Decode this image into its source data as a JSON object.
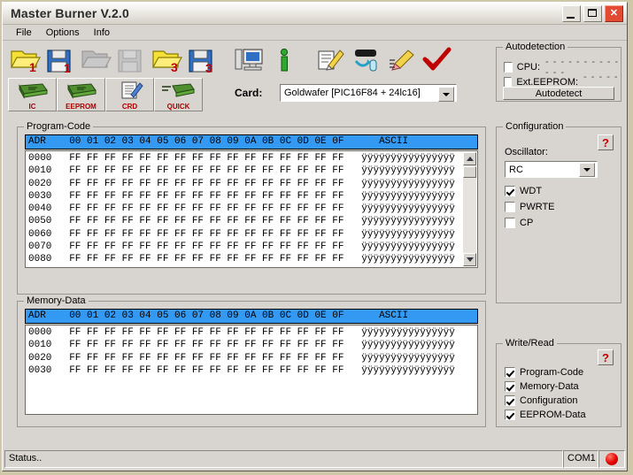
{
  "window": {
    "title": "Master Burner V.2.0",
    "minimize_label": "Minimize",
    "maximize_label": "Maximize",
    "close_label": "✕"
  },
  "menu": [
    "File",
    "Options",
    "Info"
  ],
  "toolbar": {
    "icons": [
      {
        "name": "open-program-file-1",
        "badge": "1"
      },
      {
        "name": "save-program-file-1",
        "badge": "1"
      },
      {
        "name": "open-file-disabled",
        "badge": ""
      },
      {
        "name": "save-file-disabled",
        "badge": ""
      },
      {
        "name": "open-file-3",
        "badge": "3"
      },
      {
        "name": "save-file-3",
        "badge": "3"
      },
      {
        "name": "computer-settings",
        "badge": ""
      },
      {
        "name": "info",
        "badge": ""
      },
      {
        "name": "write-card",
        "badge": ""
      },
      {
        "name": "read-card",
        "badge": ""
      },
      {
        "name": "erase-card",
        "badge": ""
      },
      {
        "name": "verify-card",
        "badge": ""
      }
    ]
  },
  "card_tabs": [
    {
      "label": "IC"
    },
    {
      "label": "EEPROM"
    },
    {
      "label": "CRD"
    },
    {
      "label": "QUICK"
    }
  ],
  "card": {
    "label": "Card:",
    "selected": "Goldwafer [PIC16F84 + 24lc16]"
  },
  "autodetection": {
    "caption": "Autodetection",
    "cpu_label": "CPU:",
    "cpu_value": "- - - - - - - - - - - - -",
    "cpu_checked": false,
    "eeprom_label": "Ext.EEPROM:",
    "eeprom_value": "- - - - - - -",
    "eeprom_checked": false,
    "button_label": "Autodetect"
  },
  "configuration": {
    "caption": "Configuration",
    "help_label": "?",
    "oscillator_label": "Oscillator:",
    "oscillator_value": "RC",
    "options": [
      {
        "label": "WDT",
        "checked": true
      },
      {
        "label": "PWRTE",
        "checked": false
      },
      {
        "label": "CP",
        "checked": false
      }
    ]
  },
  "write_read": {
    "caption": "Write/Read",
    "help_label": "?",
    "options": [
      {
        "label": "Program-Code",
        "checked": true
      },
      {
        "label": "Memory-Data",
        "checked": true
      },
      {
        "label": "Configuration",
        "checked": true
      },
      {
        "label": "EEPROM-Data",
        "checked": true
      }
    ]
  },
  "program_code": {
    "caption": "Program-Code",
    "header": "ADR    00 01 02 03 04 05 06 07 08 09 0A 0B 0C 0D 0E 0F      ASCII",
    "rows": [
      "0000   FF FF FF FF FF FF FF FF FF FF FF FF FF FF FF FF   ÿÿÿÿÿÿÿÿÿÿÿÿÿÿÿÿ",
      "0010   FF FF FF FF FF FF FF FF FF FF FF FF FF FF FF FF   ÿÿÿÿÿÿÿÿÿÿÿÿÿÿÿÿ",
      "0020   FF FF FF FF FF FF FF FF FF FF FF FF FF FF FF FF   ÿÿÿÿÿÿÿÿÿÿÿÿÿÿÿÿ",
      "0030   FF FF FF FF FF FF FF FF FF FF FF FF FF FF FF FF   ÿÿÿÿÿÿÿÿÿÿÿÿÿÿÿÿ",
      "0040   FF FF FF FF FF FF FF FF FF FF FF FF FF FF FF FF   ÿÿÿÿÿÿÿÿÿÿÿÿÿÿÿÿ",
      "0050   FF FF FF FF FF FF FF FF FF FF FF FF FF FF FF FF   ÿÿÿÿÿÿÿÿÿÿÿÿÿÿÿÿ",
      "0060   FF FF FF FF FF FF FF FF FF FF FF FF FF FF FF FF   ÿÿÿÿÿÿÿÿÿÿÿÿÿÿÿÿ",
      "0070   FF FF FF FF FF FF FF FF FF FF FF FF FF FF FF FF   ÿÿÿÿÿÿÿÿÿÿÿÿÿÿÿÿ",
      "0080   FF FF FF FF FF FF FF FF FF FF FF FF FF FF FF FF   ÿÿÿÿÿÿÿÿÿÿÿÿÿÿÿÿ"
    ]
  },
  "memory_data": {
    "caption": "Memory-Data",
    "header": "ADR    00 01 02 03 04 05 06 07 08 09 0A 0B 0C 0D 0E 0F      ASCII",
    "rows": [
      "0000   FF FF FF FF FF FF FF FF FF FF FF FF FF FF FF FF   ÿÿÿÿÿÿÿÿÿÿÿÿÿÿÿÿ",
      "0010   FF FF FF FF FF FF FF FF FF FF FF FF FF FF FF FF   ÿÿÿÿÿÿÿÿÿÿÿÿÿÿÿÿ",
      "0020   FF FF FF FF FF FF FF FF FF FF FF FF FF FF FF FF   ÿÿÿÿÿÿÿÿÿÿÿÿÿÿÿÿ",
      "0030   FF FF FF FF FF FF FF FF FF FF FF FF FF FF FF FF   ÿÿÿÿÿÿÿÿÿÿÿÿÿÿÿÿ"
    ]
  },
  "statusbar": {
    "status": "Status..",
    "port": "COM1",
    "led_color": "#e60000"
  },
  "colors": {
    "header_blue": "#3399f3",
    "face": "#d8d4d0",
    "label_red": "#b00000"
  }
}
